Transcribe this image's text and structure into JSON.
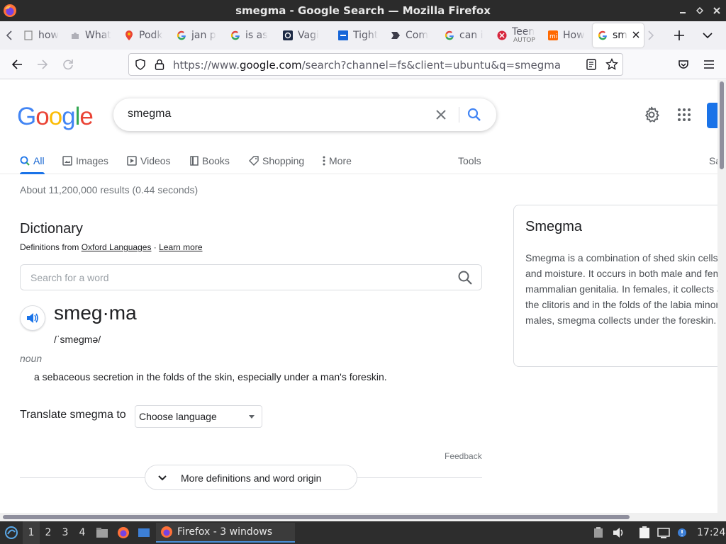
{
  "window": {
    "title": "smegma - Google Search — Mozilla Firefox"
  },
  "tabs": [
    {
      "label": "how",
      "favicon": "page-icon"
    },
    {
      "label": "What",
      "favicon": "puzzle-icon"
    },
    {
      "label": "Podk",
      "favicon": "maps-pin-icon"
    },
    {
      "label": "jan p",
      "favicon": "google-g-icon"
    },
    {
      "label": "is as",
      "favicon": "google-g-icon"
    },
    {
      "label": "Vagi",
      "favicon": "dark-square-icon"
    },
    {
      "label": "Tight",
      "favicon": "blue-square-icon"
    },
    {
      "label": "Com",
      "favicon": "chevron-tag-icon"
    },
    {
      "label": "can i",
      "favicon": "google-g-icon"
    },
    {
      "label": "Teen",
      "sublabel": "AUTOP",
      "favicon": "red-tag-icon"
    },
    {
      "label": "How",
      "favicon": "mi-icon"
    },
    {
      "label": "sm",
      "favicon": "google-g-icon",
      "active": true
    }
  ],
  "navbar": {
    "url_prefix": "https://www.",
    "url_domain": "google.com",
    "url_rest": "/search?channel=fs&client=ubuntu&q=smegma"
  },
  "search": {
    "logo": "Google",
    "query": "smegma",
    "tabs": [
      {
        "label": "All",
        "active": true,
        "icon": "search-icon"
      },
      {
        "label": "Images",
        "icon": "image-icon"
      },
      {
        "label": "Videos",
        "icon": "video-icon"
      },
      {
        "label": "Books",
        "icon": "book-icon"
      },
      {
        "label": "Shopping",
        "icon": "tag-icon"
      },
      {
        "label": "More",
        "icon": "more-vert-icon"
      }
    ],
    "tools_label": "Tools",
    "safe_label": "Sa",
    "stats": "About 11,200,000 results (0.44 seconds)"
  },
  "dictionary": {
    "title": "Dictionary",
    "source_prefix": "Definitions from ",
    "source_link": "Oxford Languages",
    "source_sep": " · ",
    "learn_more": "Learn more",
    "search_placeholder": "Search for a word",
    "headword": "smeg·ma",
    "pronunciation": "/ˈsmeɡmə/",
    "part_of_speech": "noun",
    "definition": "a sebaceous secretion in the folds of the skin, especially under a man's foreskin.",
    "translate_label": "Translate smegma to",
    "language_select": "Choose language",
    "feedback": "Feedback",
    "more_definitions": "More definitions and word origin"
  },
  "knowledge_panel": {
    "title": "Smegma",
    "description": "Smegma is a combination of shed skin cells\nand moisture. It occurs in both male and fem\nmammalian genitalia. In females, it collects a\nthe clitoris and in the folds of the labia minor\nmales, smegma collects under the foreskin."
  },
  "taskbar": {
    "workspaces": [
      "1",
      "2",
      "3",
      "4"
    ],
    "active_workspace": "1",
    "task_label": "Firefox - 3 windows",
    "clock": "17:24"
  },
  "colors": {
    "google_blue": "#4285F4",
    "google_red": "#EA4335",
    "google_yellow": "#FBBC05",
    "google_green": "#34A853",
    "link_blue": "#1a73e8"
  }
}
